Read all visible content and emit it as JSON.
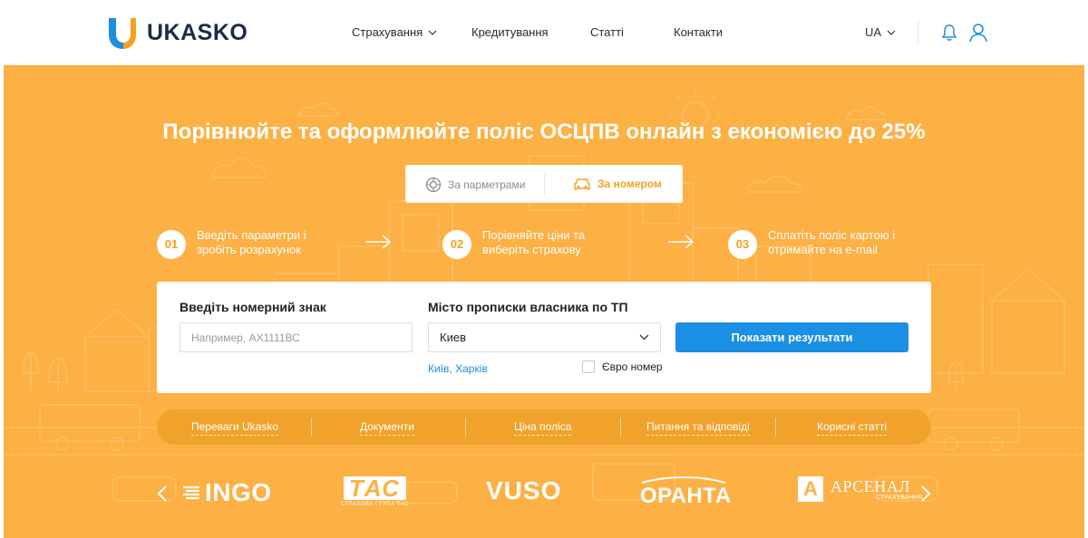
{
  "header": {
    "brand": "UKASKO",
    "nav": [
      {
        "label": "Страхування",
        "has_dropdown": true
      },
      {
        "label": "Кредитування",
        "has_dropdown": false
      },
      {
        "label": "Статті",
        "has_dropdown": false
      },
      {
        "label": "Контакти",
        "has_dropdown": false
      }
    ],
    "language": "UA",
    "icons": [
      "bell-icon",
      "user-icon"
    ]
  },
  "hero": {
    "title": "Порівнюйте та оформлюйте поліс ОСЦПВ онлайн з економією до 25%",
    "tabs": [
      {
        "label": "За парметрами",
        "icon": "tire-icon",
        "active": false
      },
      {
        "label": "За номером",
        "icon": "car-icon",
        "active": true
      }
    ],
    "steps": [
      {
        "num": "01",
        "text": "Введіть параметри і зробіть розрахунок"
      },
      {
        "num": "02",
        "text": "Порівняйте ціни та виберіть страхову"
      },
      {
        "num": "03",
        "text": "Сплатіть поліс картою і отримайте на e-mail"
      }
    ]
  },
  "form": {
    "plate_label": "Введіть номерний знак",
    "plate_placeholder": "Например, АХ1111ВС",
    "city_label": "Місто прописки власника по ТП",
    "city_value": "Киев",
    "city_hints": "Київ, Харків",
    "euro_label": "Євро номер",
    "euro_checked": false,
    "submit_label": "Показати результати"
  },
  "links": [
    "Переваги Ukasko",
    "Документи",
    "Ціна поліса",
    "Питання та відповіді",
    "Корисні статті"
  ],
  "partners": {
    "ingo": "INGO",
    "tas": "ТАС",
    "tas_sub": "СТРАХОВА ГРУПА ТАС",
    "vuso": "VUSO",
    "oranta": "ОРАНТА",
    "arsenal_mark": "A",
    "arsenal": "АРСЕНАЛ",
    "arsenal_sub": "СТРАХУВАННЯ"
  },
  "colors": {
    "hero_bg": "#fdb043",
    "accent": "#f5a11c",
    "button": "#1a8fe3",
    "brand_dark": "#1d2b4a"
  }
}
